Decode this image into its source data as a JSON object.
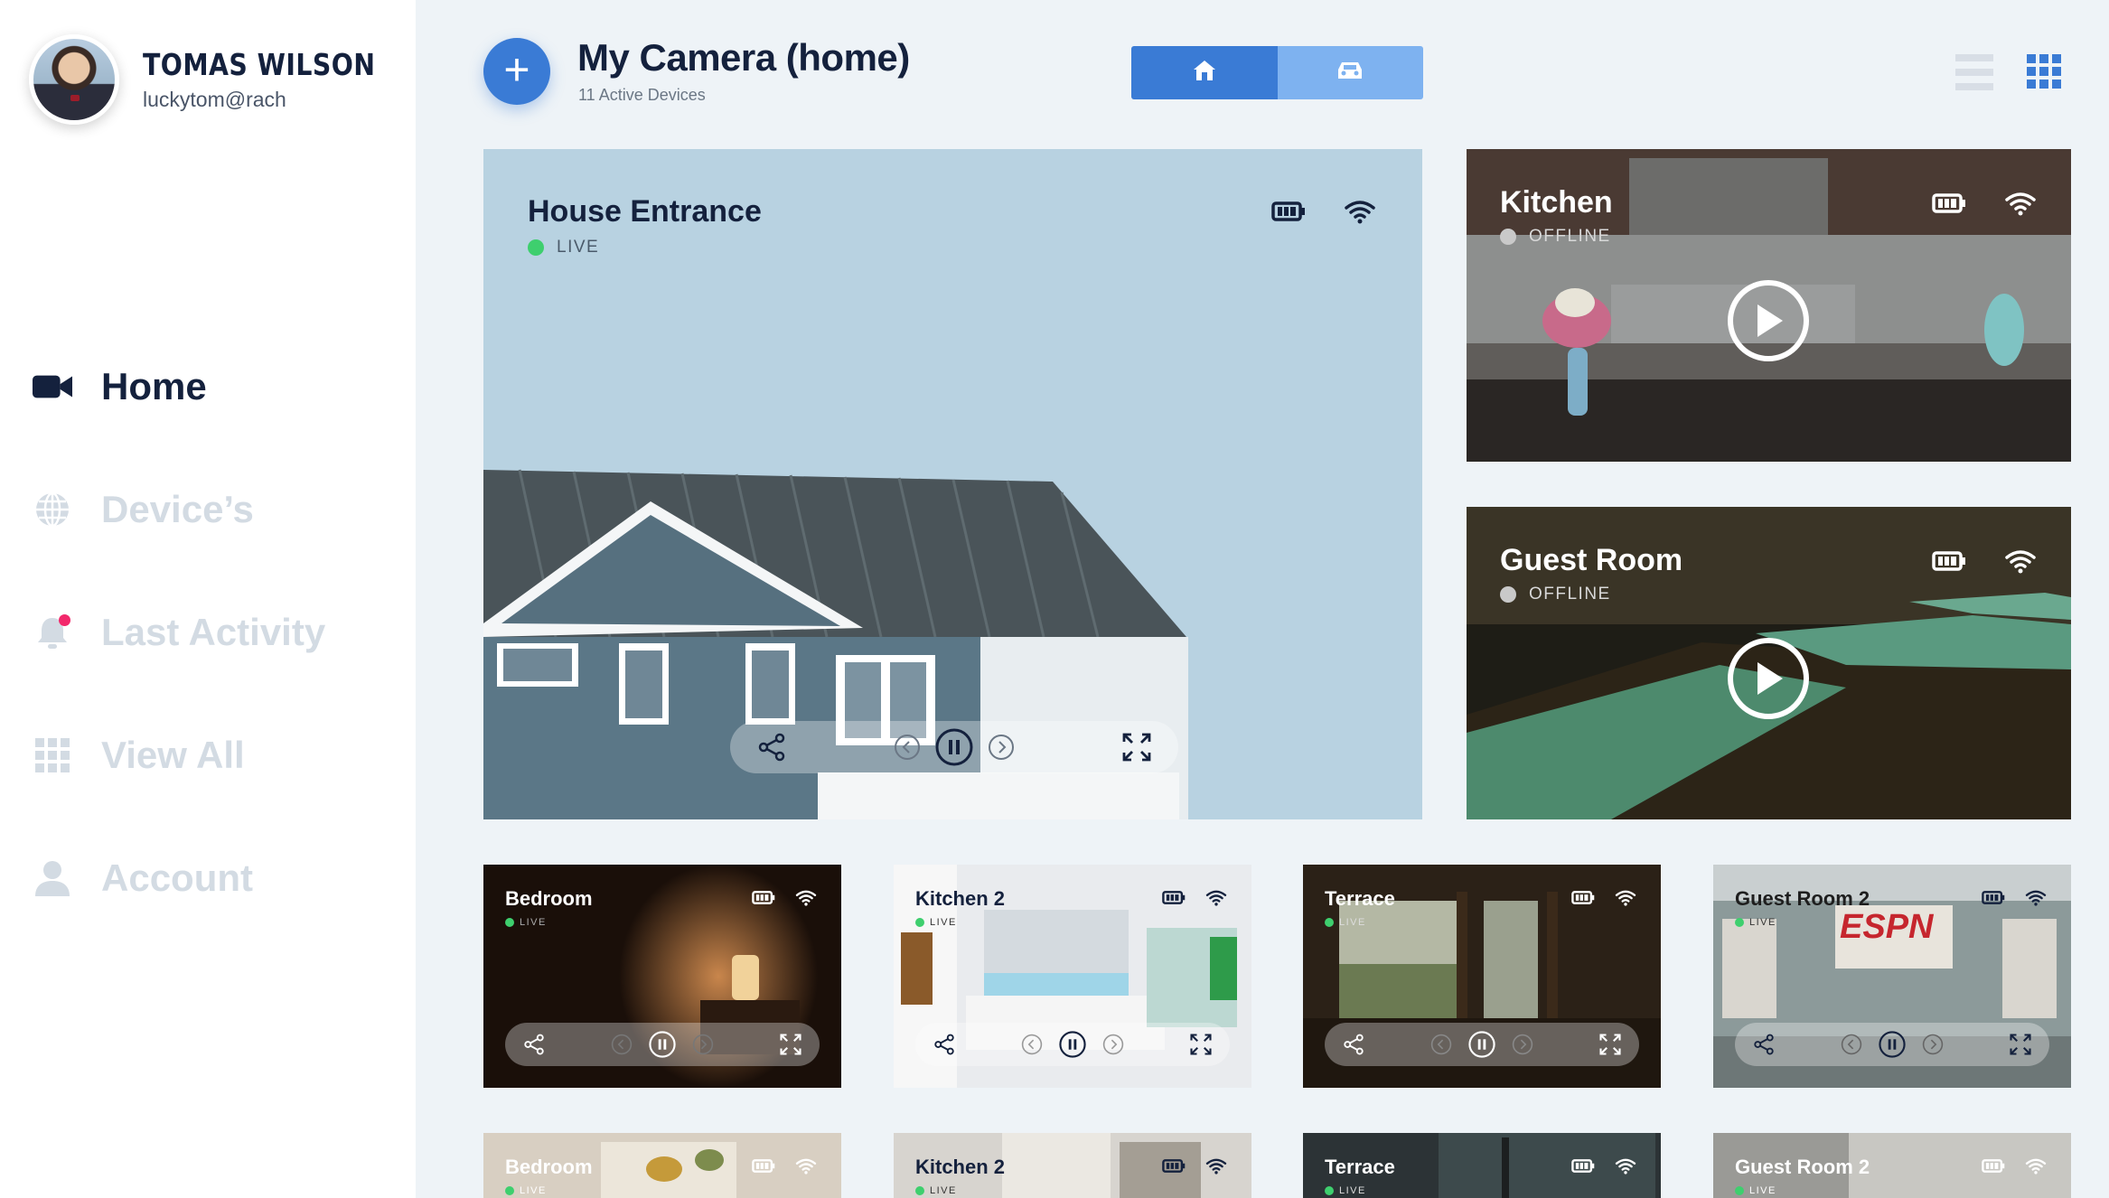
{
  "user": {
    "name": "TOMAS WILSON",
    "email": "luckytom@rach"
  },
  "nav": [
    {
      "label": "Home",
      "icon": "video-camera-icon",
      "active": true
    },
    {
      "label": "Device’s",
      "icon": "globe-icon",
      "active": false
    },
    {
      "label": "Last Activity",
      "icon": "bell-icon",
      "active": false,
      "badge": true
    },
    {
      "label": "View All",
      "icon": "grid-icon",
      "active": false
    },
    {
      "label": "Account",
      "icon": "user-icon",
      "active": false
    }
  ],
  "header": {
    "add_label": "+",
    "title": "My Camera (home)",
    "subtitle": "11 Active Devices",
    "segments": [
      {
        "icon": "home-icon",
        "selected": true
      },
      {
        "icon": "car-icon",
        "selected": false
      }
    ],
    "view_modes": [
      {
        "icon": "list-view-icon",
        "selected": false
      },
      {
        "icon": "grid-view-icon",
        "selected": true
      }
    ]
  },
  "featured": {
    "title": "House Entrance",
    "status": "LIVE"
  },
  "side_cards": [
    {
      "title": "Kitchen",
      "status": "OFFLINE"
    },
    {
      "title": "Guest Room",
      "status": "OFFLINE"
    }
  ],
  "grid_row1": [
    {
      "title": "Bedroom",
      "status": "LIVE"
    },
    {
      "title": "Kitchen 2",
      "status": "LIVE"
    },
    {
      "title": "Terrace",
      "status": "LIVE"
    },
    {
      "title": "Guest Room 2",
      "status": "LIVE"
    }
  ],
  "grid_row2": [
    {
      "title": "Bedroom",
      "status": "LIVE"
    },
    {
      "title": "Kitchen 2",
      "status": "LIVE"
    },
    {
      "title": "Terrace",
      "status": "LIVE"
    },
    {
      "title": "Guest Room 2",
      "status": "LIVE"
    }
  ],
  "overlay_text": {
    "espn": "ESPN"
  },
  "colors": {
    "accent": "#3a7bd5",
    "accent_light": "#7eb2f0",
    "live": "#3ecf6e",
    "offline": "#c9c9c9",
    "badge": "#f2286b",
    "nav_inactive": "#d3dbe3"
  }
}
